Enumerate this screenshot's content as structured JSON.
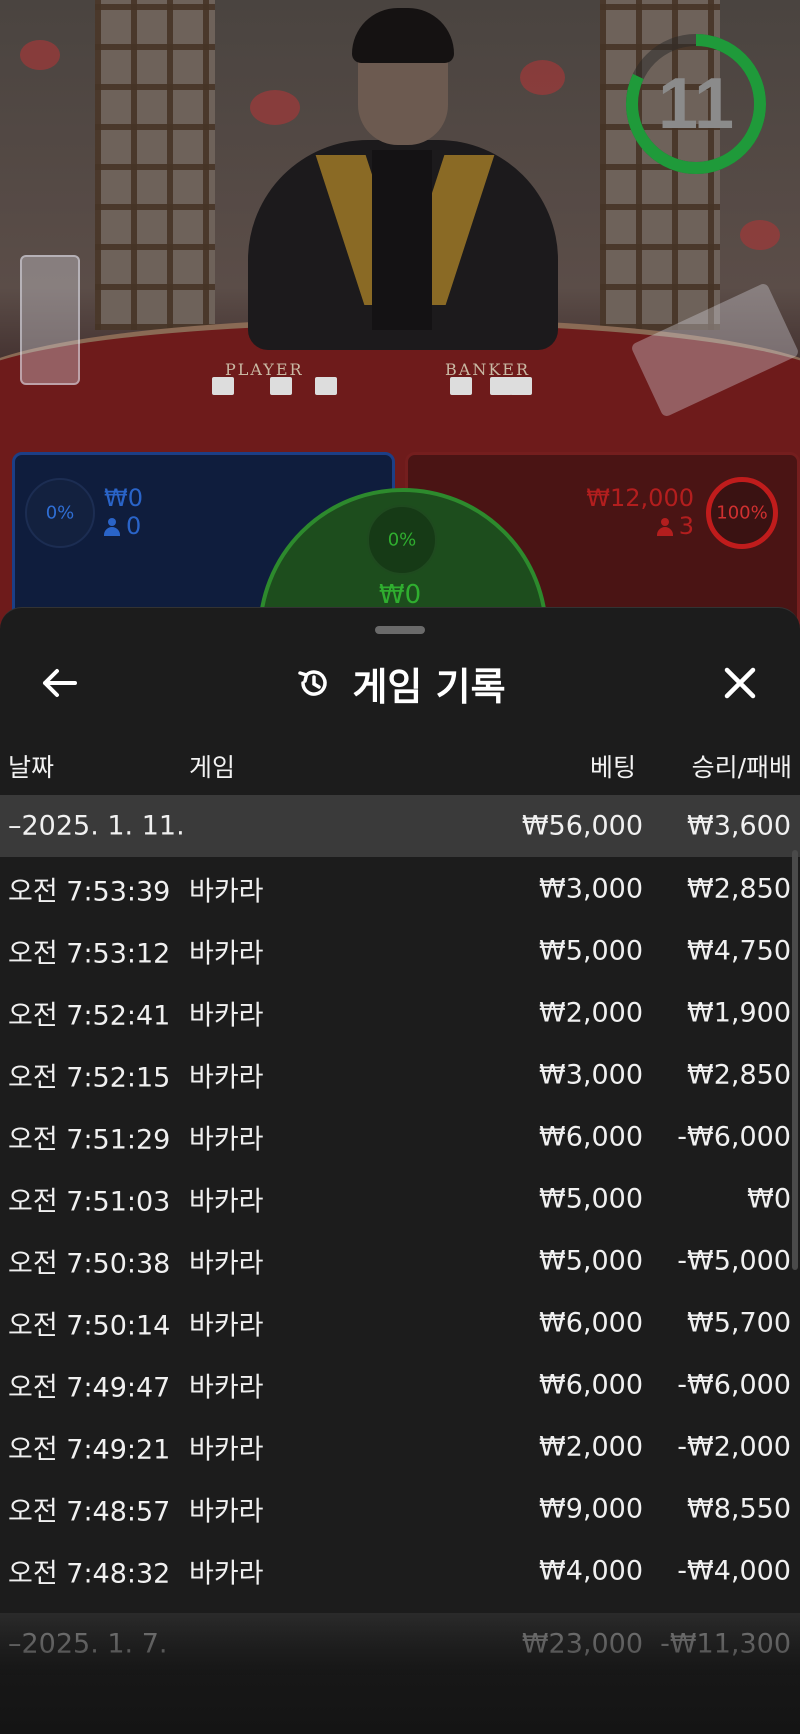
{
  "video": {
    "timer": "11",
    "player_label": "PLAYER",
    "banker_label": "BANKER",
    "player_bet": {
      "percent": "0%",
      "amount": "₩0",
      "players": "0"
    },
    "tie_bet": {
      "percent": "0%",
      "amount": "₩0"
    },
    "banker_bet": {
      "percent": "100%",
      "amount": "₩12,000",
      "players": "3"
    },
    "colors": {
      "player": "#2a64c8",
      "banker": "#c01c1c",
      "tie": "#2fae2f",
      "timer_ring": "#1f9a3a"
    }
  },
  "sheet": {
    "title": "게임 기록",
    "icons": {
      "back": "arrow-left-icon",
      "history": "history-icon",
      "close": "close-icon"
    },
    "columns": {
      "date": "날짜",
      "game": "게임",
      "bet": "베팅",
      "result": "승리/패배"
    },
    "groups": [
      {
        "date": "–2025. 1. 11.",
        "bet_total": "₩56,000",
        "result_total": "₩3,600",
        "rows": [
          {
            "time": "오전 7:53:39",
            "game": "바카라",
            "bet": "₩3,000",
            "result": "₩2,850"
          },
          {
            "time": "오전 7:53:12",
            "game": "바카라",
            "bet": "₩5,000",
            "result": "₩4,750"
          },
          {
            "time": "오전 7:52:41",
            "game": "바카라",
            "bet": "₩2,000",
            "result": "₩1,900"
          },
          {
            "time": "오전 7:52:15",
            "game": "바카라",
            "bet": "₩3,000",
            "result": "₩2,850"
          },
          {
            "time": "오전 7:51:29",
            "game": "바카라",
            "bet": "₩6,000",
            "result": "-₩6,000"
          },
          {
            "time": "오전 7:51:03",
            "game": "바카라",
            "bet": "₩5,000",
            "result": "₩0"
          },
          {
            "time": "오전 7:50:38",
            "game": "바카라",
            "bet": "₩5,000",
            "result": "-₩5,000"
          },
          {
            "time": "오전 7:50:14",
            "game": "바카라",
            "bet": "₩6,000",
            "result": "₩5,700"
          },
          {
            "time": "오전 7:49:47",
            "game": "바카라",
            "bet": "₩6,000",
            "result": "-₩6,000"
          },
          {
            "time": "오전 7:49:21",
            "game": "바카라",
            "bet": "₩2,000",
            "result": "-₩2,000"
          },
          {
            "time": "오전 7:48:57",
            "game": "바카라",
            "bet": "₩9,000",
            "result": "₩8,550"
          },
          {
            "time": "오전 7:48:32",
            "game": "바카라",
            "bet": "₩4,000",
            "result": "-₩4,000"
          }
        ]
      },
      {
        "date": "–2025. 1. 7.",
        "bet_total": "₩23,000",
        "result_total": "-₩11,300",
        "rows": []
      }
    ]
  }
}
